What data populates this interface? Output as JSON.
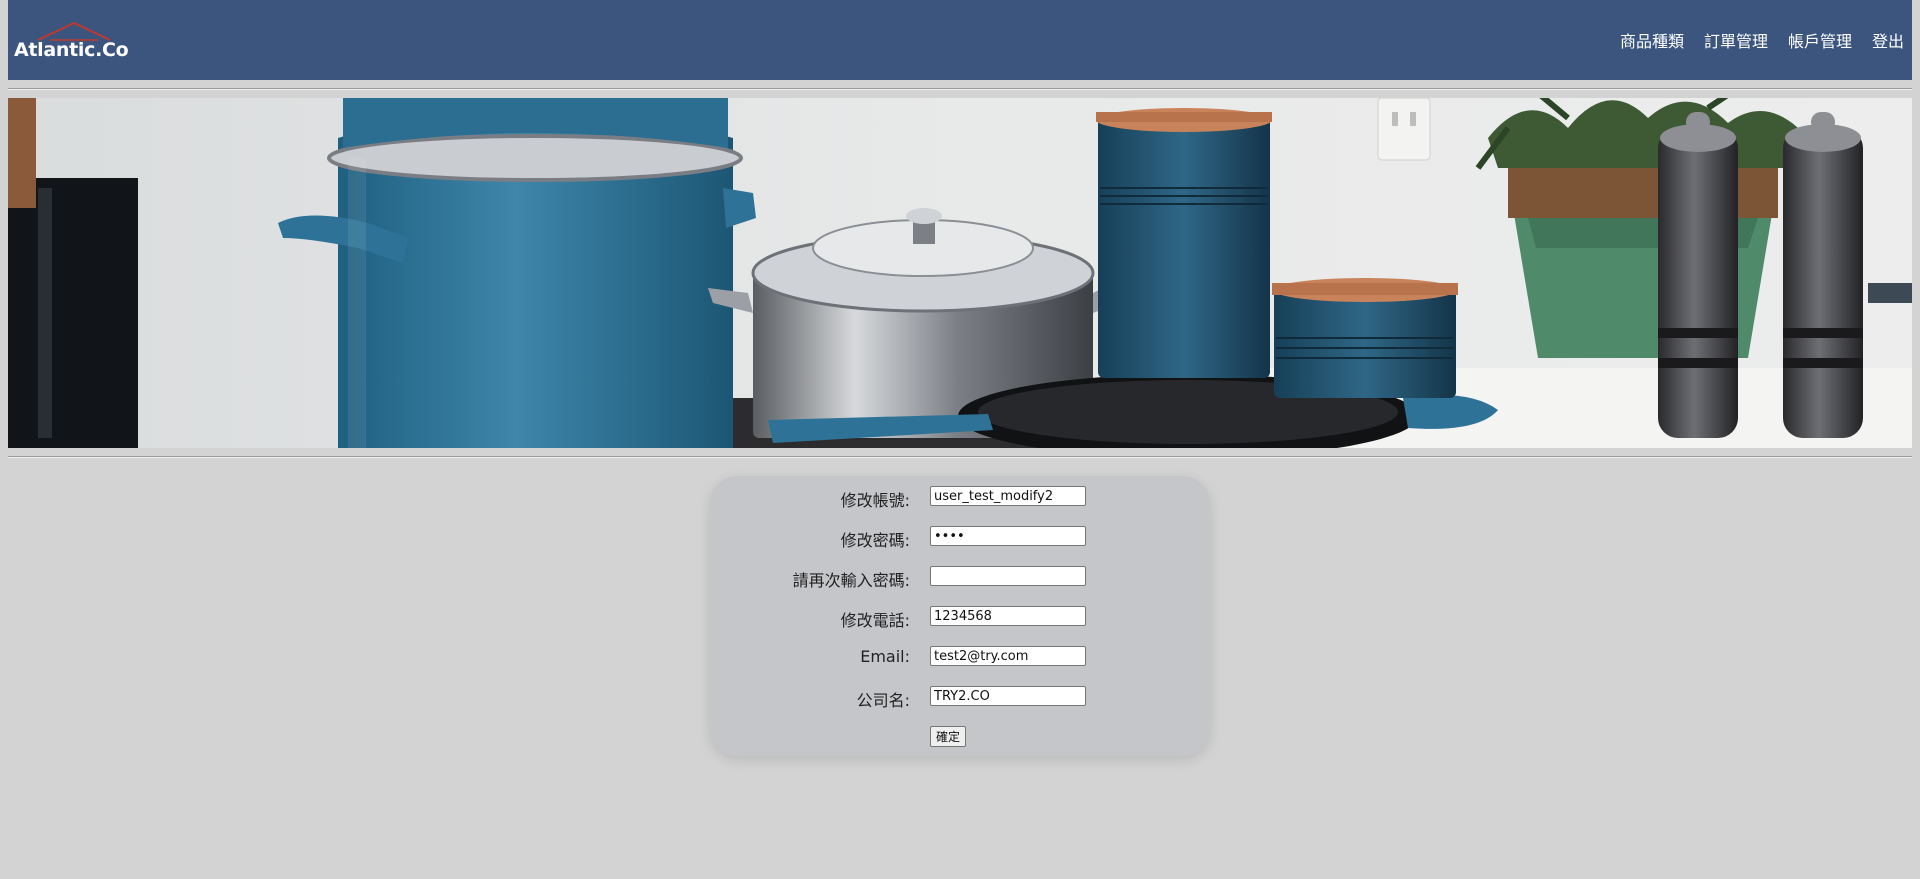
{
  "header": {
    "logo_text": "Atlantic.Co",
    "brand_color": "#3b557e",
    "logo_roof_color": "#c0392b",
    "nav": [
      {
        "label": "商品種類"
      },
      {
        "label": "訂單管理"
      },
      {
        "label": "帳戶管理"
      },
      {
        "label": "登出"
      }
    ]
  },
  "banner": {
    "icon": "kitchen-cookware-photo"
  },
  "form": {
    "fields": [
      {
        "label": "修改帳號:",
        "value": "user_test_modify2",
        "type": "text"
      },
      {
        "label": "修改密碼:",
        "value": "••••",
        "type": "password"
      },
      {
        "label": "請再次輸入密碼:",
        "value": "",
        "type": "password"
      },
      {
        "label": "修改電話:",
        "value": "1234568",
        "type": "text"
      },
      {
        "label": "Email:",
        "value": "test2@try.com",
        "type": "text"
      },
      {
        "label": "公司名:",
        "value": "TRY2.CO",
        "type": "text"
      }
    ],
    "submit_label": "確定"
  }
}
